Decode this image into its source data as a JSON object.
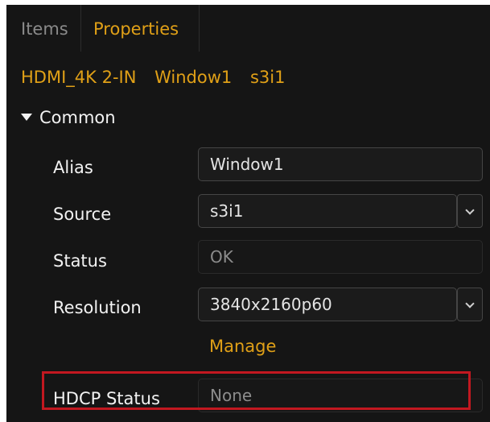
{
  "tabs": {
    "items_label": "Items",
    "properties_label": "Properties"
  },
  "breadcrumb": {
    "device": "HDMI_4K 2-IN",
    "window": "Window1",
    "source": "s3i1"
  },
  "section": {
    "title": "Common"
  },
  "properties": {
    "alias": {
      "label": "Alias",
      "value": "Window1"
    },
    "source": {
      "label": "Source",
      "value": "s3i1"
    },
    "status": {
      "label": "Status",
      "value": "OK"
    },
    "resolution": {
      "label": "Resolution",
      "value": "3840x2160p60"
    },
    "manage_label": "Manage",
    "hdcp_status": {
      "label": "HDCP Status",
      "value": "None"
    }
  },
  "colors": {
    "accent": "#e0a017",
    "panel_background": "#151515",
    "highlight_border": "#c21820"
  }
}
